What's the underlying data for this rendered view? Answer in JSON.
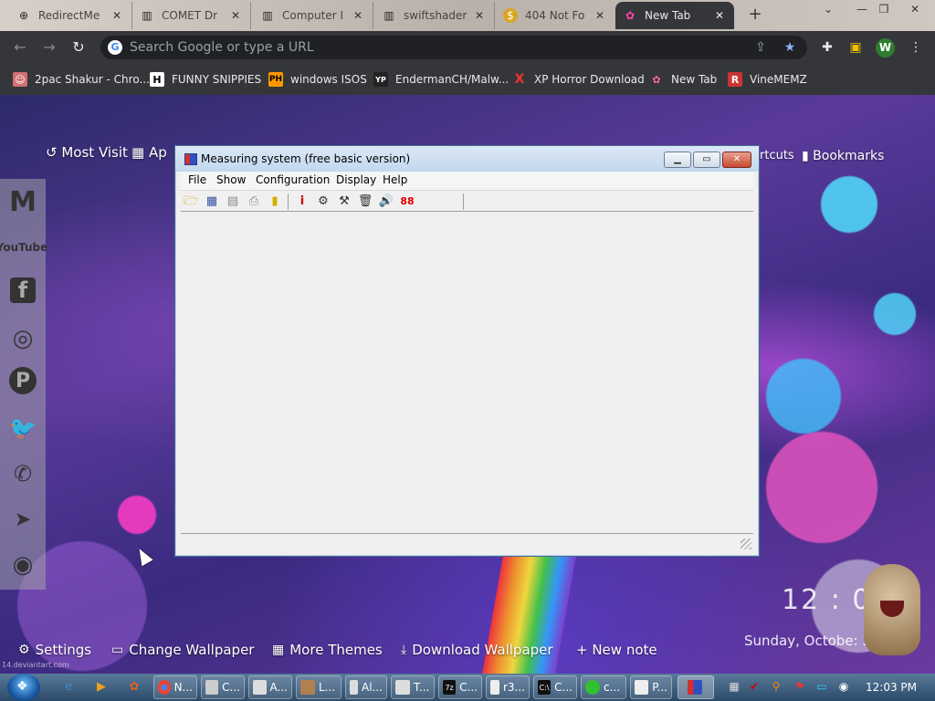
{
  "browser": {
    "tabs": [
      {
        "title": "RedirectMe",
        "favicon": "globe-icon"
      },
      {
        "title": "COMET Dr",
        "favicon": "museum-icon"
      },
      {
        "title": "Computer I",
        "favicon": "museum-icon"
      },
      {
        "title": "swiftshader",
        "favicon": "museum-icon"
      },
      {
        "title": "404 Not Fo",
        "favicon": "coin-icon"
      },
      {
        "title": "New Tab",
        "favicon": "pony-icon"
      }
    ],
    "omnibox": {
      "placeholder": "Search Google or type a URL",
      "google_letter": "G"
    },
    "profile_letter": "W",
    "bookmarks": [
      {
        "label": "2pac Shakur - Chro...",
        "icon": "person-icon",
        "glyph": "☺"
      },
      {
        "label": "FUNNY SNIPPIES",
        "icon": "h-logo-icon",
        "glyph": "H"
      },
      {
        "label": "windows ISOS",
        "icon": "ph-logo-icon",
        "glyph": "PH"
      },
      {
        "label": "EndermanCH/Malw...",
        "icon": "yp-logo-icon",
        "glyph": "YP"
      },
      {
        "label": "XP Horror Download",
        "icon": "x-logo-icon",
        "glyph": "X"
      },
      {
        "label": "New Tab",
        "icon": "pony-icon",
        "glyph": "✿"
      },
      {
        "label": "VineMEMZ",
        "icon": "r-logo-icon",
        "glyph": "R"
      }
    ]
  },
  "newtab": {
    "most_visited": "Most Visit",
    "apps": "Ap",
    "shortcuts": "rtcuts",
    "bookmarks": "Bookmarks",
    "social": [
      "M",
      "YouTube",
      "f",
      "◎",
      "P",
      "🐦",
      "✆",
      "➤",
      "◉"
    ],
    "bottom": {
      "settings": "Settings",
      "change_wallpaper": "Change Wallpaper",
      "more_themes": "More Themes",
      "download_wallpaper": "Download Wallpaper",
      "new_note": "+ New note"
    },
    "clock": "12 : 03",
    "date": "Sunday, Octobe: 30",
    "deviant": "14.deviantart.com"
  },
  "app_window": {
    "title": "Measuring system (free basic version)",
    "menus": [
      "File",
      "Show",
      "Configuration",
      "Display",
      "Help"
    ]
  },
  "taskbar": {
    "buttons": [
      "N...",
      "C...",
      "A...",
      "L...",
      "Al...",
      "T...",
      "C...",
      "r3...",
      "C...",
      "c...",
      "P..."
    ],
    "time": "12:03 PM"
  },
  "colors": {
    "chrome_dark": "#35363a",
    "accent_blue": "#8ab4f8"
  }
}
